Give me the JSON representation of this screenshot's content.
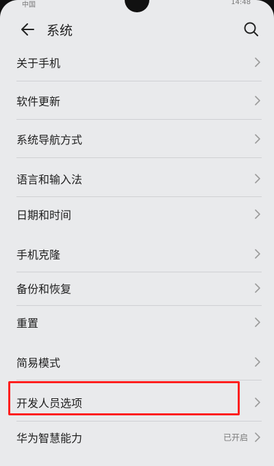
{
  "status_bar": {
    "left": "中国",
    "right": "14:48"
  },
  "header": {
    "title": "系统"
  },
  "list": {
    "items": [
      {
        "label": "关于手机"
      },
      {
        "label": "软件更新"
      },
      {
        "label": "系统导航方式"
      },
      {
        "label": "语言和输入法"
      },
      {
        "label": "日期和时间"
      },
      {
        "label": "手机克隆"
      },
      {
        "label": "备份和恢复"
      },
      {
        "label": "重置"
      },
      {
        "label": "简易模式"
      },
      {
        "label": "开发人员选项"
      },
      {
        "label": "华为智慧能力",
        "status": "已开启"
      }
    ]
  },
  "icons": {
    "back": "back-arrow-icon",
    "search": "search-icon",
    "chevron": "chevron-right-icon"
  },
  "colors": {
    "highlight": "#ff1e1e",
    "background": "#e9eaec"
  }
}
